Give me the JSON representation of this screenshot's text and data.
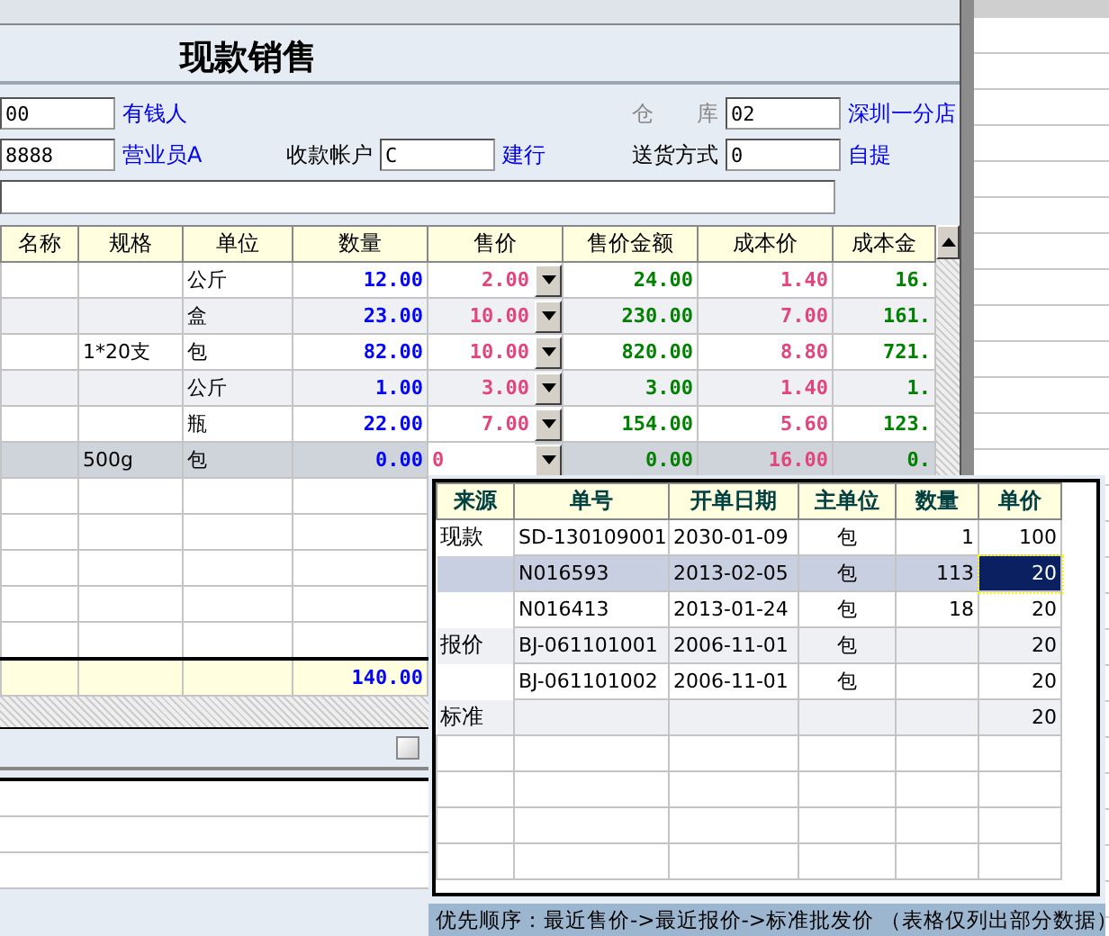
{
  "title": "现款销售",
  "form": [
    {
      "value": "00",
      "link": "有钱人"
    },
    {
      "label": "仓　　库",
      "value": "02",
      "link": "深圳一分店",
      "dim": true
    },
    {
      "value": "8888",
      "link": "营业员A"
    },
    {
      "label": "收款帐户",
      "value": "C",
      "link": "建行",
      "dim": false
    },
    {
      "label": "送货方式",
      "value": "0",
      "link": "自提",
      "dim": false
    }
  ],
  "grid": {
    "columns": [
      "名称",
      "规格",
      "单位",
      "数量",
      "售价",
      "售价金额",
      "成本价",
      "成本金"
    ],
    "rows": [
      {
        "selected": false,
        "cells": [
          "",
          "",
          "公斤",
          "12.00",
          "2.00",
          "24.00",
          "1.40",
          "16."
        ]
      },
      {
        "selected": false,
        "cells": [
          "",
          "",
          "盒",
          "23.00",
          "10.00",
          "230.00",
          "7.00",
          "161."
        ]
      },
      {
        "selected": false,
        "cells": [
          "",
          "1*20支",
          "包",
          "82.00",
          "10.00",
          "820.00",
          "8.80",
          "721."
        ]
      },
      {
        "selected": false,
        "cells": [
          "",
          "",
          "公斤",
          "1.00",
          "3.00",
          "3.00",
          "1.40",
          "1."
        ]
      },
      {
        "selected": false,
        "cells": [
          "",
          "",
          "瓶",
          "22.00",
          "7.00",
          "154.00",
          "5.60",
          "123."
        ]
      },
      {
        "selected": true,
        "cells": [
          "",
          "500g",
          "包",
          "0.00",
          "0",
          "0.00",
          "16.00",
          "0."
        ]
      }
    ],
    "total": "140.00"
  },
  "popup": {
    "columns": [
      "来源",
      "单号",
      "开单日期",
      "主单位",
      "数量",
      "单价"
    ],
    "rows": [
      {
        "selected": false,
        "cells": [
          "现款",
          "SD-130109001",
          "2030-01-09",
          "包",
          "1",
          "100"
        ]
      },
      {
        "selected": true,
        "cells": [
          "",
          "N016593",
          "2013-02-05",
          "包",
          "113",
          "20"
        ]
      },
      {
        "selected": false,
        "cells": [
          "",
          "N016413",
          "2013-01-24",
          "包",
          "18",
          "20"
        ]
      },
      {
        "selected": false,
        "cells": [
          "报价",
          "BJ-061101001",
          "2006-11-01",
          "包",
          "",
          "20"
        ]
      },
      {
        "selected": false,
        "cells": [
          "",
          "BJ-061101002",
          "2006-11-01",
          "包",
          "",
          "20"
        ]
      },
      {
        "selected": false,
        "cells": [
          "标准",
          "",
          "",
          "",
          "",
          "20"
        ]
      }
    ],
    "note": "优先顺序：最近售价->最近报价->标准批发价 （表格仅列出部分数据）"
  }
}
